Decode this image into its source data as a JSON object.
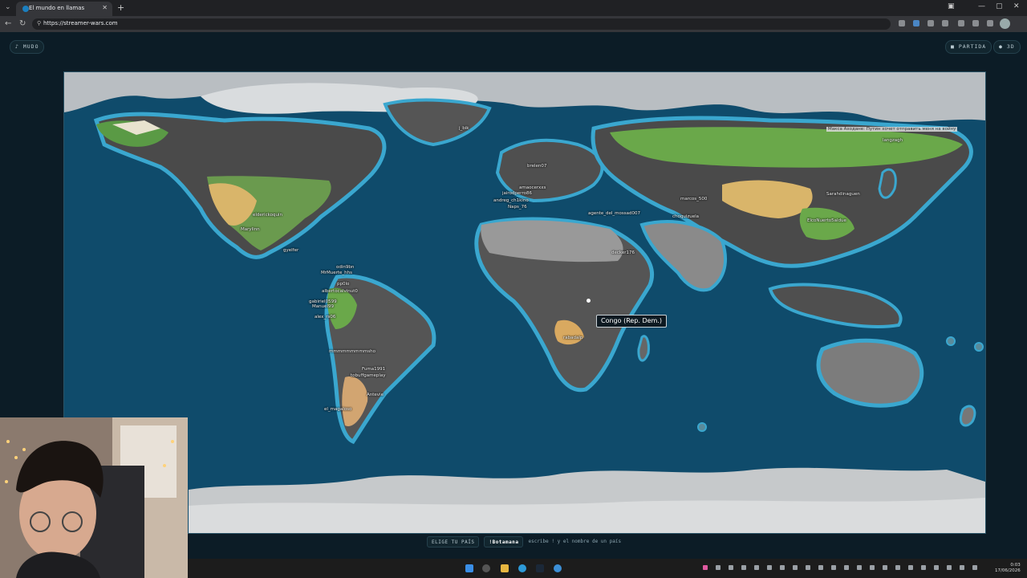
{
  "browser": {
    "tab_title": "El mundo en llamas",
    "url": "https://streamer-wars.com"
  },
  "header": {
    "mute_label": "♪ MUDO",
    "game_label": "PARTIDA",
    "view_label": "3D"
  },
  "map": {
    "tooltip": "Congo (Rep. Dem.)",
    "labels": [
      {
        "text": "Макса Аходане: Путин хочет отправить меня на войну",
        "name": "chat-overlay"
      },
      {
        "text": "elderickoquin",
        "name": "player-usa"
      },
      {
        "text": "Marylinn",
        "name": "player-mexico"
      },
      {
        "text": "gyelfer",
        "name": "player-central"
      },
      {
        "text": "odin9bn",
        "name": "player-a"
      },
      {
        "text": "MrMuerte_hhs",
        "name": "player-b"
      },
      {
        "text": "pp0lo",
        "name": "player-c"
      },
      {
        "text": "albertocalvinut0",
        "name": "player-d"
      },
      {
        "text": "gabiriel0599",
        "name": "player-e"
      },
      {
        "text": "Manuel99",
        "name": "player-f"
      },
      {
        "text": "alex_rs06",
        "name": "player-g"
      },
      {
        "text": "mmmmmmmmmsho",
        "name": "player-h"
      },
      {
        "text": "Fuma1991",
        "name": "player-i"
      },
      {
        "text": "tobuffgameplay",
        "name": "player-j"
      },
      {
        "text": "Antevie",
        "name": "player-k"
      },
      {
        "text": "el_magaloso",
        "name": "player-l"
      },
      {
        "text": "j_bik",
        "name": "player-m"
      },
      {
        "text": "brelen07",
        "name": "player-n"
      },
      {
        "text": "amaocerxxs",
        "name": "player-o"
      },
      {
        "text": "jairodperro86",
        "name": "player-p"
      },
      {
        "text": "andreg_ch1kino",
        "name": "player-q"
      },
      {
        "text": "Naps_76",
        "name": "player-r"
      },
      {
        "text": "agente_del_mossad007",
        "name": "player-s"
      },
      {
        "text": "decker176",
        "name": "player-t"
      },
      {
        "text": "marcos_500",
        "name": "player-u"
      },
      {
        "text": "choquizuela",
        "name": "player-v"
      },
      {
        "text": "Sarahdinaguen",
        "name": "player-w"
      },
      {
        "text": "ElcoNuerto5aldue",
        "name": "player-x"
      },
      {
        "text": "langzagh",
        "name": "player-y"
      },
      {
        "text": "rabadalp",
        "name": "player-z"
      }
    ]
  },
  "bottombar": {
    "choose_label": "ELIGE TU PAÍS",
    "command": "!Botamana",
    "hint": "escribe ! y el nombre de un país"
  },
  "taskbar": {
    "time": "0:03",
    "date": "17/06/2026"
  }
}
